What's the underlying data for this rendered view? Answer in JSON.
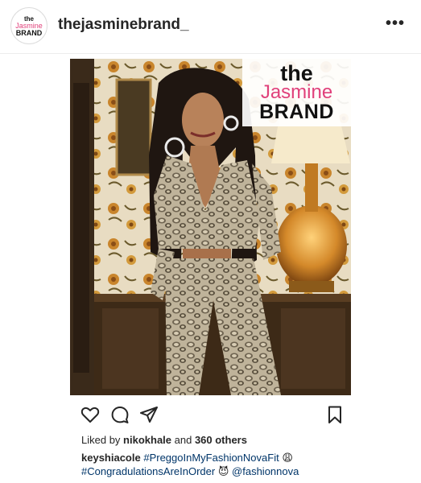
{
  "header": {
    "avatar_the": "the",
    "avatar_jasmine": "Jasmine",
    "avatar_brand": "BRAND",
    "username": "thejasminebrand_",
    "more_label": "•••"
  },
  "photo": {
    "watermark_the": "the",
    "watermark_jasmine": "Jasmine",
    "watermark_brand": "BRAND"
  },
  "actions": {
    "icons": [
      "heart-icon",
      "comment-icon",
      "share-icon",
      "bookmark-icon"
    ]
  },
  "likes": {
    "prefix": "Liked by ",
    "user": "nikokhale",
    "middle": " and ",
    "count": "360 others"
  },
  "caption": {
    "user": "keyshiacole",
    "hashtag1": "#PreggoInMyFashionNovaFit",
    "emoji1": "😩",
    "hashtag2": "#CongradulationsAreInOrder",
    "emoji2": "😈",
    "mention": "@fashionnova"
  }
}
